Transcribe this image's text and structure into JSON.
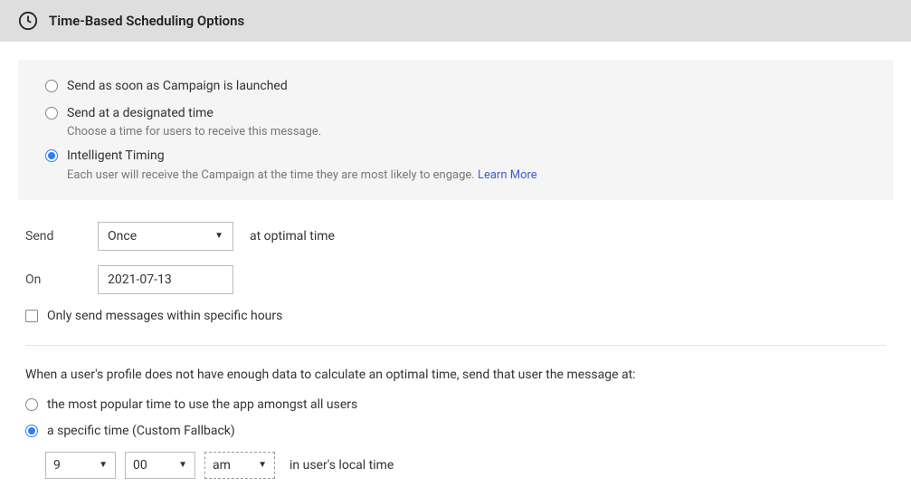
{
  "header": {
    "title": "Time-Based Scheduling Options"
  },
  "options": {
    "send_launch": {
      "label": "Send as soon as Campaign is launched"
    },
    "send_designated": {
      "label": "Send at a designated time",
      "sub": "Choose a time for users to receive this message."
    },
    "intelligent": {
      "label": "Intelligent Timing",
      "sub": "Each user will receive the Campaign at the time they are most likely to engage. ",
      "learn_more": "Learn More"
    }
  },
  "schedule": {
    "send_label": "Send",
    "frequency": "Once",
    "at_optimal": "at optimal time",
    "on_label": "On",
    "date": "2021-07-13"
  },
  "within_hours": {
    "label": "Only send messages within specific hours"
  },
  "fallback": {
    "intro": "When a user's profile does not have enough data to calculate an optimal time, send that user the message at:",
    "popular": {
      "label": "the most popular time to use the app amongst all users"
    },
    "specific": {
      "label": "a specific time (Custom Fallback)"
    },
    "time": {
      "hour": "9",
      "minute": "00",
      "ampm": "am",
      "tz": "in user's local time"
    }
  }
}
